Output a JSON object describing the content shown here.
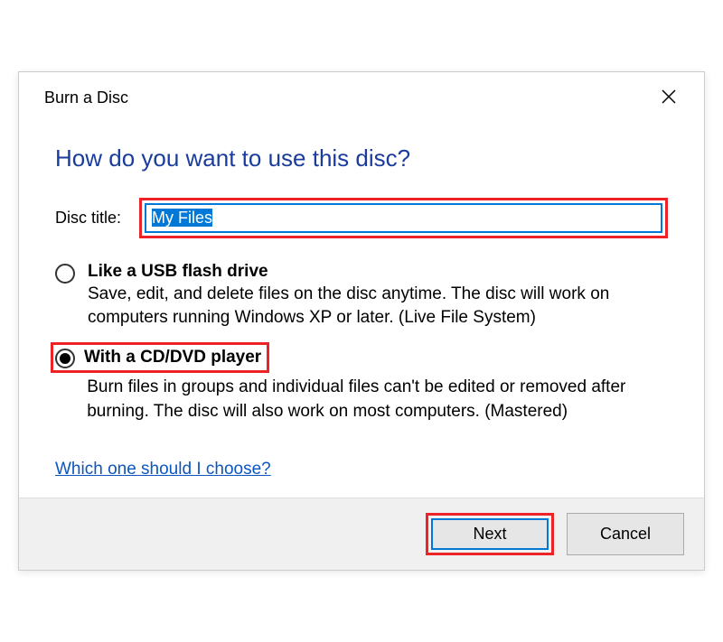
{
  "titlebar": {
    "title": "Burn a Disc"
  },
  "heading": "How do you want to use this disc?",
  "disc_title": {
    "label": "Disc title:",
    "value": "My Files"
  },
  "options": [
    {
      "title": "Like a USB flash drive",
      "desc": "Save, edit, and delete files on the disc anytime. The disc will work on computers running Windows XP or later. (Live File System)",
      "selected": false
    },
    {
      "title": "With a CD/DVD player",
      "desc": "Burn files in groups and individual files can't be edited or removed after burning. The disc will also work on most computers. (Mastered)",
      "selected": true
    }
  ],
  "help_link": "Which one should I choose?",
  "buttons": {
    "next": "Next",
    "cancel": "Cancel"
  }
}
